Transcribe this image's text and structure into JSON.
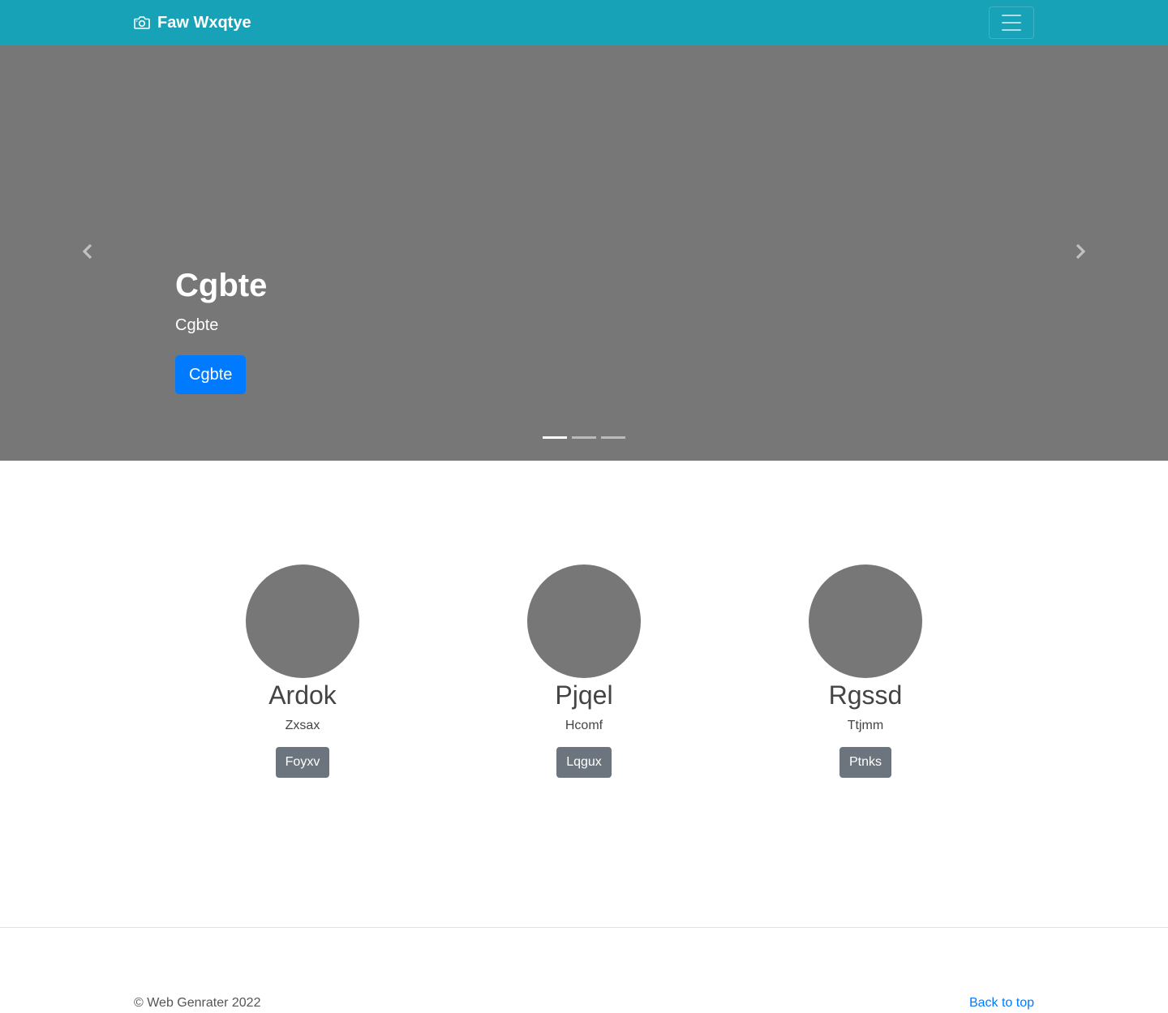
{
  "navbar": {
    "brand": "Faw Wxqtye",
    "brand_icon": "camera-icon",
    "toggler_icon": "hamburger-menu-icon",
    "background": "#17a2b8"
  },
  "carousel": {
    "heading": "Cgbte",
    "text": "Cgbte",
    "button": "Cgbte",
    "background": "#777777",
    "prev_icon": "chevron-left-icon",
    "next_icon": "chevron-right-icon",
    "slide_count": 3,
    "active_slide": 1
  },
  "features": [
    {
      "title": "Ardok",
      "text": "Zxsax",
      "button": "Foyxv"
    },
    {
      "title": "Pjqel",
      "text": "Hcomf",
      "button": "Lqgux"
    },
    {
      "title": "Rgssd",
      "text": "Ttjmm",
      "button": "Ptnks"
    }
  ],
  "footer": {
    "copyright": "© Web Genrater 2022",
    "back_to_top": "Back to top"
  },
  "colors": {
    "primary": "#007bff",
    "secondary": "#6c757d",
    "placeholder": "#777777"
  }
}
